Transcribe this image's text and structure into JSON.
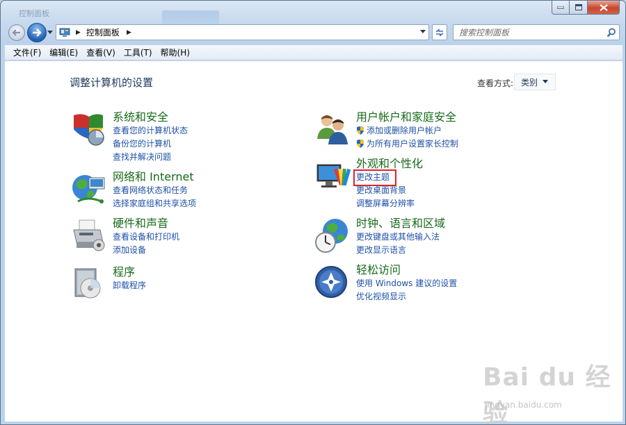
{
  "window": {
    "frame_title": "控制面板",
    "address_path": "控制面板",
    "search_placeholder": "搜索控制面板"
  },
  "menu": [
    "文件(F)",
    "编辑(E)",
    "查看(V)",
    "工具(T)",
    "帮助(H)"
  ],
  "main": {
    "title": "调整计算机的设置",
    "view_by_label": "查看方式:",
    "view_by_value": "类别"
  },
  "categories": [
    {
      "icon": "shield-icon",
      "title": "系统和安全",
      "links": [
        "查看您的计算机状态",
        "备份您的计算机",
        "查找并解决问题"
      ]
    },
    {
      "icon": "network-globe-icon",
      "title": "网络和 Internet",
      "links": [
        "查看网络状态和任务",
        "选择家庭组和共享选项"
      ]
    },
    {
      "icon": "printer-icon",
      "title": "硬件和声音",
      "links": [
        "查看设备和打印机",
        "添加设备"
      ]
    },
    {
      "icon": "programs-disc-icon",
      "title": "程序",
      "links": [
        "卸载程序"
      ]
    },
    {
      "icon": "users-icon",
      "title": "用户帐户和家庭安全",
      "links": [
        "添加或删除用户帐户",
        "为所有用户设置家长控制"
      ],
      "shield_links": true
    },
    {
      "icon": "display-palette-icon",
      "title": "外观和个性化",
      "links": [
        "更改主题",
        "更改桌面背景",
        "调整屏幕分辨率"
      ]
    },
    {
      "icon": "clock-globe-icon",
      "title": "时钟、语言和区域",
      "links": [
        "更改键盘或其他输入法",
        "更改显示语言"
      ]
    },
    {
      "icon": "accessibility-icon",
      "title": "轻松访问",
      "links": [
        "使用 Windows 建议的设置",
        "优化视频显示"
      ]
    }
  ],
  "highlighted_link": "更改主题",
  "watermark": {
    "logo": "Bai du 经验",
    "url": "jingyan.baidu.com"
  },
  "colors": {
    "category_title": "#166a1a",
    "link": "#1e50a8",
    "highlight": "#e0202a"
  }
}
